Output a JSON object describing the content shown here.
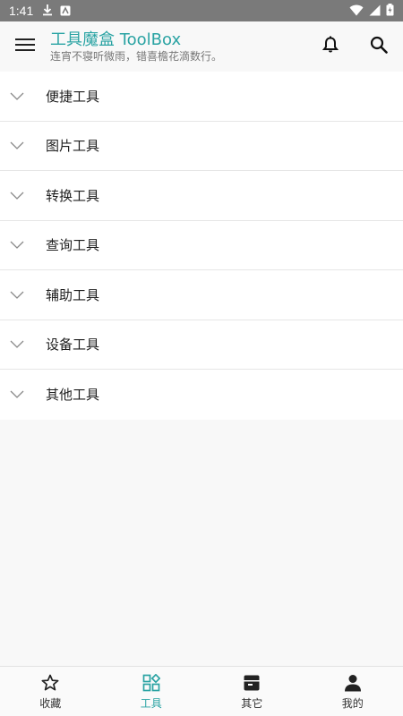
{
  "status_bar": {
    "time": "1:41"
  },
  "app_bar": {
    "title": "工具魔盒 ToolBox",
    "subtitle": "连宵不寝听微雨，错喜檐花滴数行。"
  },
  "categories": [
    {
      "label": "便捷工具"
    },
    {
      "label": "图片工具"
    },
    {
      "label": "转换工具"
    },
    {
      "label": "查询工具"
    },
    {
      "label": "辅助工具"
    },
    {
      "label": "设备工具"
    },
    {
      "label": "其他工具"
    }
  ],
  "bottom_nav": [
    {
      "label": "收藏",
      "icon": "star-icon",
      "active": false
    },
    {
      "label": "工具",
      "icon": "grid-icon",
      "active": true
    },
    {
      "label": "其它",
      "icon": "box-icon",
      "active": false
    },
    {
      "label": "我的",
      "icon": "person-icon",
      "active": false
    }
  ],
  "colors": {
    "accent": "#2aa3a3",
    "status_bar": "#7a7a7a"
  }
}
